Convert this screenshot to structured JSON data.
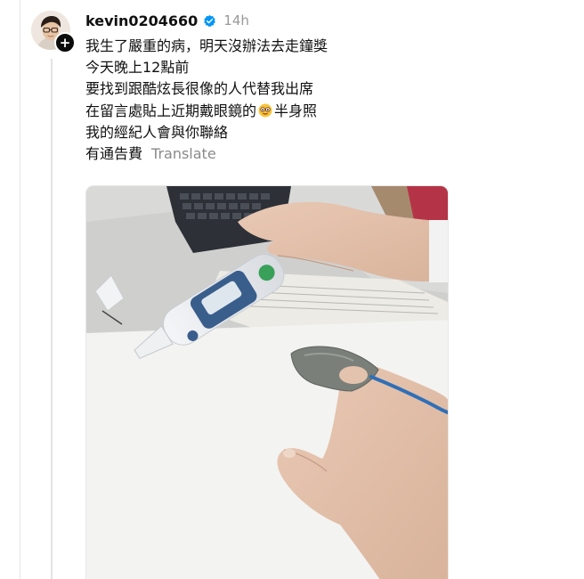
{
  "post": {
    "author": {
      "username": "kevin0204660",
      "verified": true,
      "avatar_icon": "profile-avatar",
      "follow_icon": "plus-icon"
    },
    "timestamp": "14h",
    "lines": [
      "我生了嚴重的病，明天沒辦法去走鐘獎",
      "今天晚上12點前",
      "要找到跟酷炫長很像的人代替我出席"
    ],
    "line4_before": "在留言處貼上近期戴眼鏡的",
    "line4_emoji": "glasses-face-emoji",
    "line4_after": "半身照",
    "line5": "我的經紀人會與你聯絡",
    "line6": "有通告費",
    "translate_label": "Translate",
    "media": {
      "type": "photo",
      "subject": "ear thermometer next to keyboard, finger with pulse oximeter clip"
    }
  },
  "colors": {
    "text": "#101010",
    "muted": "#999999",
    "verified_blue": "#0095f6",
    "divider": "#e3e3e3"
  }
}
